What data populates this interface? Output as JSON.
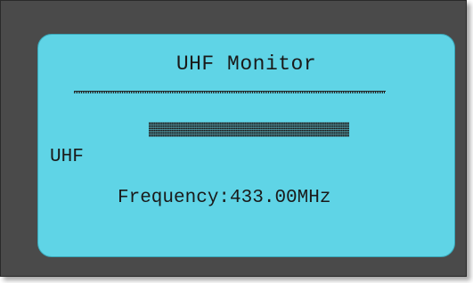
{
  "screen": {
    "title": "UHF Monitor",
    "band_label": "UHF",
    "frequency_label": "Frequency:",
    "frequency_value": "433.00MHz"
  },
  "signal": {
    "level_fraction": 1.0
  },
  "colors": {
    "lcd_background": "#5fd4e6",
    "bezel": "#4a4a4a",
    "text": "#1a1a1a"
  }
}
